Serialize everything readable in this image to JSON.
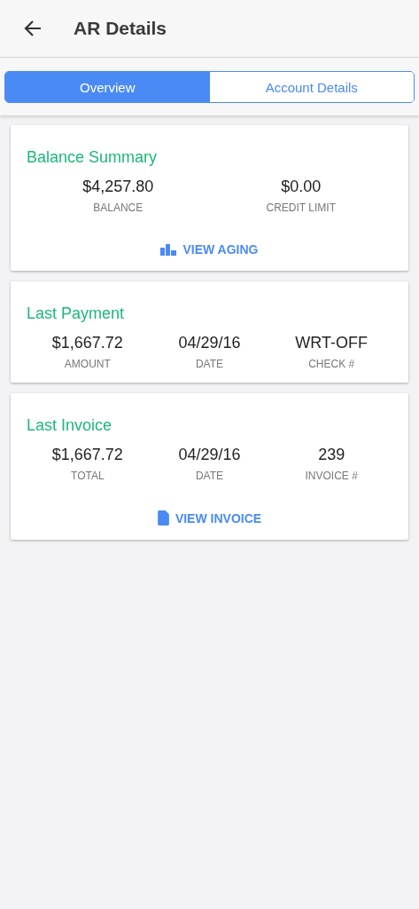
{
  "header": {
    "title": "AR Details"
  },
  "tabs": [
    {
      "label": "Overview",
      "selected": true
    },
    {
      "label": "Account Details",
      "selected": false
    }
  ],
  "cards": [
    {
      "title": "Balance Summary",
      "stats": [
        {
          "value": "$4,257.80",
          "label": "BALANCE"
        },
        {
          "value": "$0.00",
          "label": "CREDIT LIMIT"
        }
      ],
      "action": {
        "label": "VIEW AGING",
        "kind": "aging"
      }
    },
    {
      "title": "Last Payment",
      "stats": [
        {
          "value": "$1,667.72",
          "label": "AMOUNT"
        },
        {
          "value": "04/29/16",
          "label": "DATE"
        },
        {
          "value": "WRT-OFF",
          "label": "CHECK #"
        }
      ]
    },
    {
      "title": "Last Invoice",
      "stats": [
        {
          "value": "$1,667.72",
          "label": "TOTAL"
        },
        {
          "value": "04/29/16",
          "label": "DATE"
        },
        {
          "value": "239",
          "label": "INVOICE #"
        }
      ],
      "action": {
        "label": "VIEW INVOICE",
        "kind": "invoice"
      }
    }
  ]
}
